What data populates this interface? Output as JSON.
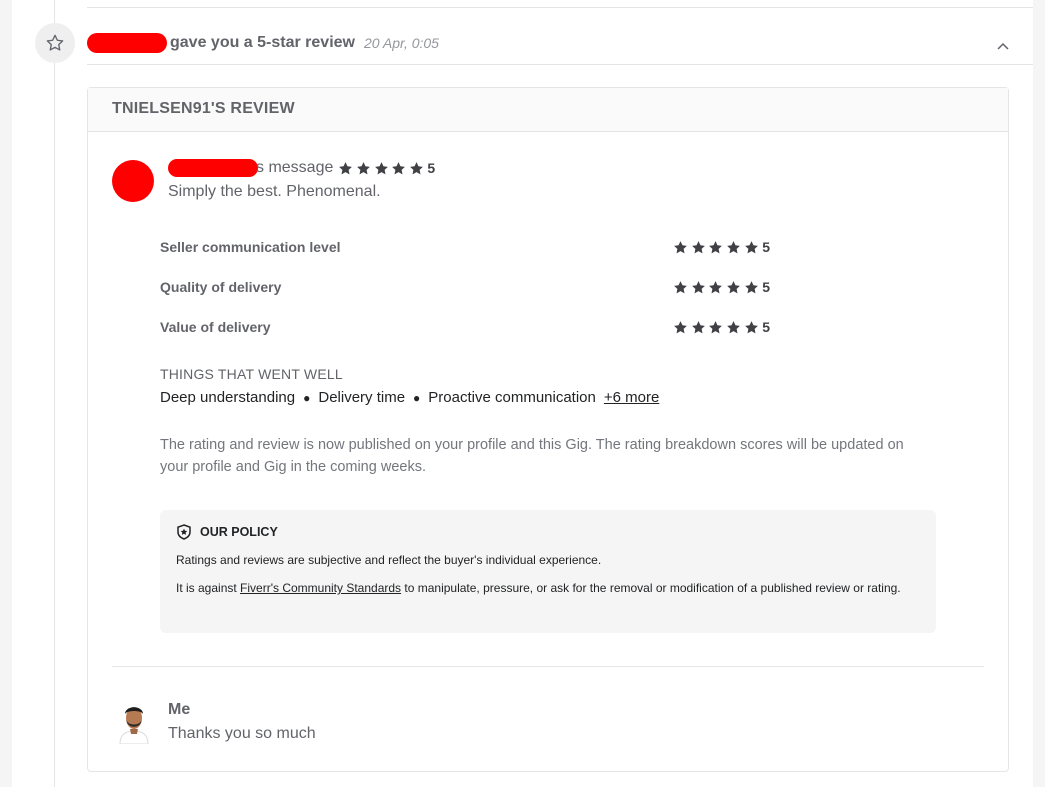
{
  "notification": {
    "text": "gave you a 5-star review",
    "date": "20 Apr, 0:05"
  },
  "review": {
    "title": "TNIELSEN91'S REVIEW",
    "message_label": "s message",
    "overall_score": "5",
    "text": "Simply the best. Phenomenal.",
    "ratings": [
      {
        "label": "Seller communication level",
        "score": "5"
      },
      {
        "label": "Quality of delivery",
        "score": "5"
      },
      {
        "label": "Value of delivery",
        "score": "5"
      }
    ],
    "went_well_title": "THINGS THAT WENT WELL",
    "went_well": [
      "Deep understanding",
      "Delivery time",
      "Proactive communication"
    ],
    "more_link": "+6 more",
    "notice": "The rating and review is now published on your profile and this Gig. The rating breakdown scores will be updated on your profile and Gig in the coming weeks."
  },
  "policy": {
    "title": "OUR POLICY",
    "line1": "Ratings and reviews are subjective and reflect the buyer's individual experience.",
    "line2_pre": "It is against ",
    "line2_link": "Fiverr's Community Standards",
    "line2_post": " to manipulate, pressure, or ask for the removal or modification of a published review or rating."
  },
  "reply": {
    "name": "Me",
    "text": "Thanks you so much"
  },
  "colors": {
    "redaction": "#ff0000",
    "star": "#404145"
  },
  "icons": [
    "star-outline-icon",
    "chevron-up-icon",
    "star-icon",
    "shield-icon",
    "avatar"
  ]
}
